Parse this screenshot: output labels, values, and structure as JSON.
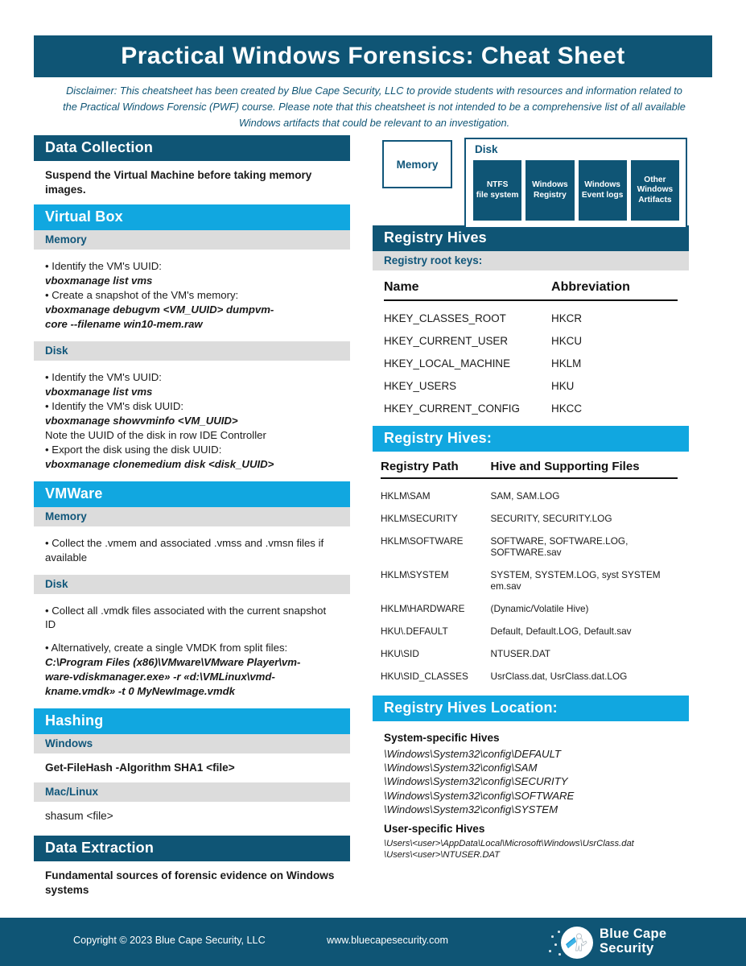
{
  "document": {
    "title": "Practical Windows Forensics: Cheat Sheet",
    "disclaimer": "Disclaimer: This cheatsheet has been created by Blue Cape Security, LLC to provide students with resources and information related to the Practical Windows Forensic (PWF) course. Please note that this cheatsheet is not intended to be a comprehensive list of all available Windows artifacts that could be relevant to an investigation."
  },
  "colors": {
    "dark_blue": "#0f5575",
    "light_blue": "#11a7e0",
    "gray_subheader": "#dcdcdc",
    "white": "#ffffff"
  },
  "left_column": {
    "data_collection": {
      "header": "Data Collection",
      "body": "Suspend the Virtual Machine before taking memory images."
    },
    "virtual_box": {
      "header": "Virtual Box",
      "memory": {
        "subheader": "Memory",
        "lines": [
          {
            "type": "bullet",
            "text": "•  Identify the VM's UUID:"
          },
          {
            "type": "cmd",
            "text": "vboxmanage list vms"
          },
          {
            "type": "bullet",
            "text": "•  Create a snapshot of the VM's memory:"
          },
          {
            "type": "cmd",
            "text": "vboxmanage debugvm <VM_UUID> dumpvm-"
          },
          {
            "type": "cmd",
            "text": "core --filename win10-mem.raw"
          }
        ]
      },
      "disk": {
        "subheader": "Disk",
        "lines": [
          {
            "type": "bullet",
            "text": "• Identify the VM's UUID:"
          },
          {
            "type": "cmd",
            "text": " vboxmanage list vms"
          },
          {
            "type": "bullet",
            "text": "•  Identify the VM's disk UUID:"
          },
          {
            "type": "cmd",
            "text": "vboxmanage showvminfo <VM_UUID>"
          },
          {
            "type": "bullet",
            "text": " Note the UUID of the disk in row IDE Controller"
          },
          {
            "type": "bullet",
            "text": "•  Export the disk using the disk UUID:"
          },
          {
            "type": "cmd",
            "text": "vboxmanage clonemedium disk <disk_UUID>"
          }
        ]
      }
    },
    "vmware": {
      "header": "VMWare",
      "memory": {
        "subheader": "Memory",
        "lines": [
          {
            "type": "bullet",
            "text": "•  Collect the .vmem and associated .vmss and .vmsn files if available"
          }
        ]
      },
      "disk": {
        "subheader": "Disk",
        "lines": [
          {
            "type": "bullet",
            "text": "•  Collect all .vmdk files associated with the current snapshot ID"
          },
          {
            "type": "gap",
            "text": ""
          },
          {
            "type": "bullet",
            "text": "•  Alternatively, create a single VMDK from split files:"
          },
          {
            "type": "cmd",
            "text": "C:\\Program Files (x86)\\VMware\\VMware Player\\vm-"
          },
          {
            "type": "cmd",
            "text": "ware-vdiskmanager.exe» -r «d:\\VMLinux\\vmd-"
          },
          {
            "type": "cmd",
            "text": "kname.vmdk» -t 0 MyNewImage.vmdk"
          }
        ]
      }
    },
    "hashing": {
      "header": "Hashing",
      "windows": {
        "subheader": "Windows",
        "command": "Get-FileHash -Algorithm SHA1 <file>"
      },
      "mac_linux": {
        "subheader": "Mac/Linux",
        "command": "shasum <file>"
      }
    },
    "data_extraction": {
      "header": "Data Extraction",
      "body": "Fundamental sources of forensic evidence on Windows systems"
    }
  },
  "right_column": {
    "diagram": {
      "memory_label": "Memory",
      "disk_label": "Disk",
      "disk_cells": [
        "NTFS\nfile system",
        "Windows\nRegistry",
        "Windows\nEvent logs",
        "Other\nWindows\nArtifacts"
      ]
    },
    "registry_hives": {
      "header": "Registry Hives",
      "subheader": "Registry root keys:",
      "columns": [
        "Name",
        "Abbreviation"
      ],
      "rows": [
        [
          "HKEY_CLASSES_ROOT",
          "HKCR"
        ],
        [
          "HKEY_CURRENT_USER",
          "HKCU"
        ],
        [
          "HKEY_LOCAL_MACHINE",
          "HKLM"
        ],
        [
          "HKEY_USERS",
          "HKU"
        ],
        [
          "HKEY_CURRENT_CONFIG",
          "HKCC"
        ]
      ]
    },
    "registry_hives_files": {
      "header": "Registry Hives:",
      "columns": [
        "Registry Path",
        "Hive and Supporting Files"
      ],
      "rows": [
        [
          "HKLM\\SAM",
          "SAM, SAM.LOG"
        ],
        [
          "HKLM\\SECURITY",
          "SECURITY, SECURITY.LOG"
        ],
        [
          "HKLM\\SOFTWARE",
          "SOFTWARE, SOFTWARE.LOG, SOFTWARE.sav"
        ],
        [
          "HKLM\\SYSTEM",
          "SYSTEM, SYSTEM.LOG, syst SYSTEM em.sav"
        ],
        [
          "HKLM\\HARDWARE",
          "(Dynamic/Volatile Hive)"
        ],
        [
          "HKU\\.DEFAULT",
          "Default, Default.LOG, Default.sav"
        ],
        [
          "HKU\\SID",
          "NTUSER.DAT"
        ],
        [
          "HKU\\SID_CLASSES",
          "UsrClass.dat, UsrClass.dat.LOG"
        ]
      ]
    },
    "registry_hives_location": {
      "header": "Registry Hives Location:",
      "system_title": "System-specific Hives",
      "system_paths": [
        "\\Windows\\System32\\config\\DEFAULT",
        "\\Windows\\System32\\config\\SAM",
        "\\Windows\\System32\\config\\SECURITY",
        "\\Windows\\System32\\config\\SOFTWARE",
        "\\Windows\\System32\\config\\SYSTEM"
      ],
      "user_title": "User-specific Hives",
      "user_paths": [
        "\\Users\\<user>\\AppData\\Local\\Microsoft\\Windows\\UsrClass.dat",
        "\\Users\\<user>\\NTUSER.DAT"
      ]
    }
  },
  "footer": {
    "copyright": "Copyright © 2023 Blue Cape Security, LLC",
    "website": "www.bluecapesecurity.com",
    "logo_line1": "Blue Cape",
    "logo_line2": "Security"
  }
}
